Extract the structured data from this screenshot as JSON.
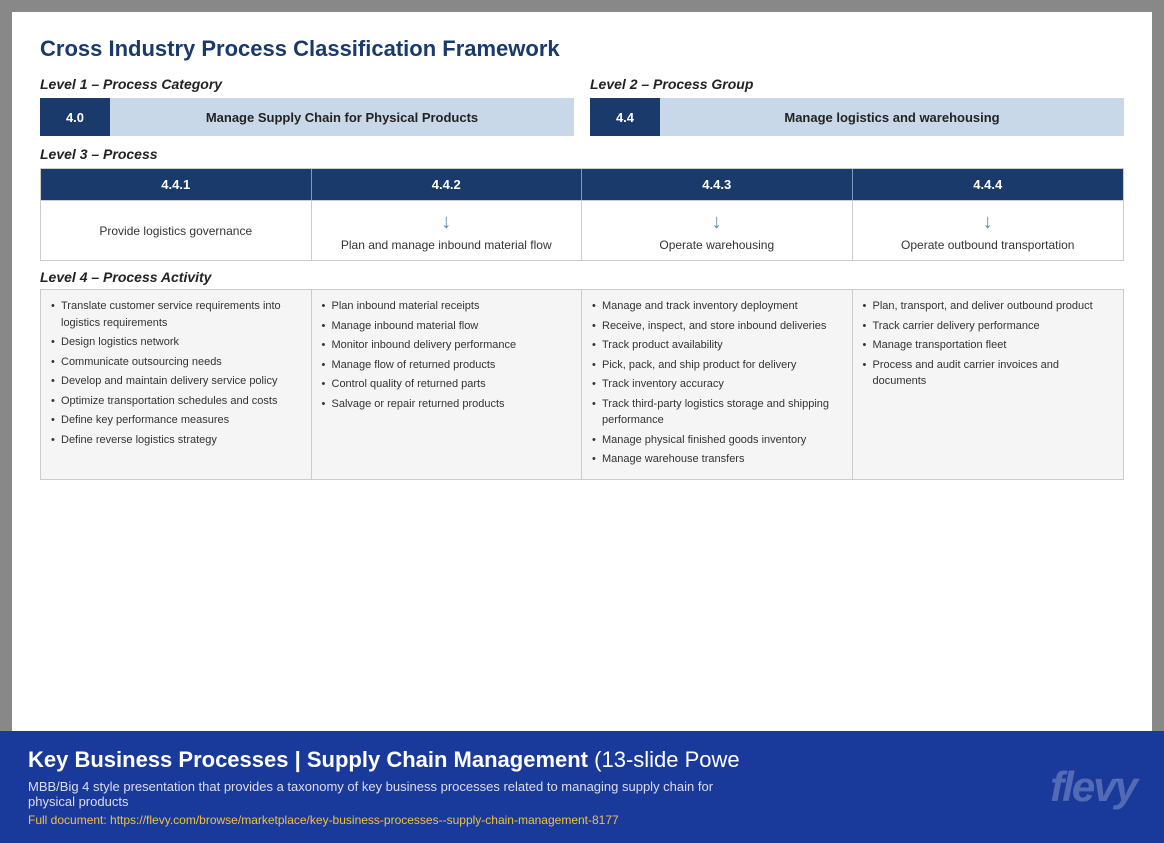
{
  "title": "Cross Industry Process Classification Framework",
  "level1_label": "Level 1 – Process Category",
  "level2_label": "Level 2 – Process Group",
  "level3_label": "Level 3 – Process",
  "level4_label": "Level 4 – Process Activity",
  "level1": {
    "badge": "4.0",
    "label": "Manage Supply Chain for Physical Products"
  },
  "level2": {
    "badge": "4.4",
    "label": "Manage logistics and warehousing"
  },
  "level3_items": [
    {
      "id": "4.4.1",
      "desc": "Provide logistics governance"
    },
    {
      "id": "4.4.2",
      "desc": "Plan and manage inbound material flow"
    },
    {
      "id": "4.4.3",
      "desc": "Operate warehousing"
    },
    {
      "id": "4.4.4",
      "desc": "Operate outbound transportation"
    }
  ],
  "level4_cols": [
    {
      "items": [
        "Translate customer service requirements into logistics requirements",
        "Design logistics network",
        "Communicate outsourcing needs",
        "Develop and maintain delivery service policy",
        "Optimize transportation schedules and costs",
        "Define key performance measures",
        "Define reverse logistics strategy"
      ]
    },
    {
      "items": [
        "Plan inbound material receipts",
        "Manage inbound material flow",
        "Monitor inbound delivery performance",
        "Manage flow of returned products",
        "Control quality of returned parts",
        "Salvage or repair returned products"
      ]
    },
    {
      "items": [
        "Manage and track inventory deployment",
        "Receive, inspect, and store inbound deliveries",
        "Track product availability",
        "Pick, pack, and ship product for delivery",
        "Track inventory accuracy",
        "Track third-party logistics storage and shipping performance",
        "Manage physical finished goods inventory",
        "Manage warehouse transfers"
      ]
    },
    {
      "items": [
        "Plan, transport, and deliver outbound product",
        "Track carrier delivery performance",
        "Manage transportation fleet",
        "Process and audit carrier invoices and documents"
      ]
    }
  ],
  "footer": {
    "title": "Key Business Processes | Supply Chain Management",
    "title_suffix": "(13-slide Powe",
    "desc": "MBB/Big 4 style presentation that provides a taxonomy of key business processes related to managing supply chain for physical products",
    "link": "Full document: https://flevy.com/browse/marketplace/key-business-processes--supply-chain-management-8177",
    "logo": "flevy"
  }
}
